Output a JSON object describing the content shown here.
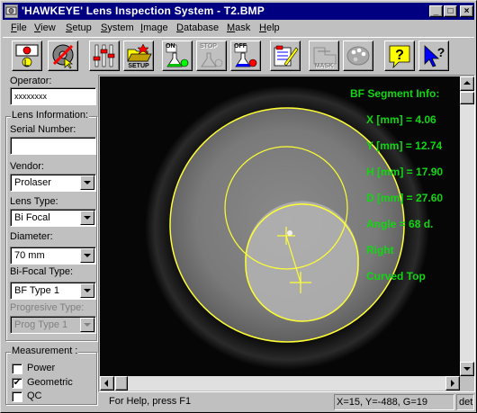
{
  "window": {
    "title": "'HAWKEYE' Lens Inspection System - T2.BMP",
    "minimize_glyph": "_",
    "maximize_glyph": "□",
    "close_glyph": "×"
  },
  "menu": [
    {
      "key": "F",
      "rest": "ile"
    },
    {
      "key": "V",
      "rest": "iew"
    },
    {
      "key": "S",
      "rest": "etup"
    },
    {
      "key": "S",
      "rest": "ystem"
    },
    {
      "key": "I",
      "rest": "mage"
    },
    {
      "key": "D",
      "rest": "atabase"
    },
    {
      "key": "M",
      "rest": "ask"
    },
    {
      "key": "H",
      "rest": "elp"
    }
  ],
  "toolbar": {
    "setup_caption": "SETUP",
    "on_caption": "ON",
    "stop_caption": "STOP",
    "off_caption": "OFF",
    "mask_caption": "MASK",
    "icons": [
      "camera-stop-icon",
      "disc-pointer-icon",
      "adjust-sliders-icon",
      "open-setup-icon",
      "on-flask-icon",
      "stop-flask-icon",
      "off-flask-icon",
      "edit-list-icon",
      "mask-icon",
      "palette-icon",
      "help-icon",
      "context-help-pointer-icon"
    ]
  },
  "left_panel": {
    "operator_label": "Operator:",
    "operator_value": "xxxxxxxx",
    "lens_info_legend": "Lens Information:",
    "serial_label": "Serial Number:",
    "serial_value": "",
    "vendor_label": "Vendor:",
    "vendor_value": "Prolaser",
    "lens_type_label": "Lens Type:",
    "lens_type_value": "Bi Focal",
    "diameter_label": "Diameter:",
    "diameter_value": "70 mm",
    "bifocal_label": "Bi-Focal Type:",
    "bifocal_value": "BF Type 1",
    "progressive_label": "Progresive Type:",
    "progressive_value": "Prog Type 1",
    "measurement_legend": "Measurement :",
    "measurements": [
      {
        "label": "Power",
        "checked": false
      },
      {
        "label": "Geometric",
        "checked": true
      },
      {
        "label": "QC",
        "checked": false
      }
    ]
  },
  "segment_info": {
    "title": "BF Segment Info:",
    "x_label": "X [mm] =",
    "x_value": "4.06",
    "y_label": "Y [mm] =",
    "y_value": "12.74",
    "h_label": "H [mm] =",
    "h_value": "17.90",
    "d_label": "D [mm] =",
    "d_value": "27.60",
    "angle_label": "Angle =",
    "angle_value": "68 d.",
    "side": "Right",
    "top_type": "Curved Top"
  },
  "colors": {
    "overlay_text": "#13d613",
    "overlay_lines": "#ffff33",
    "title_bar": "#000080"
  },
  "statusbar": {
    "help": "For Help, press F1",
    "coords": "X=15, Y=-488, G=19",
    "extra": "det"
  }
}
